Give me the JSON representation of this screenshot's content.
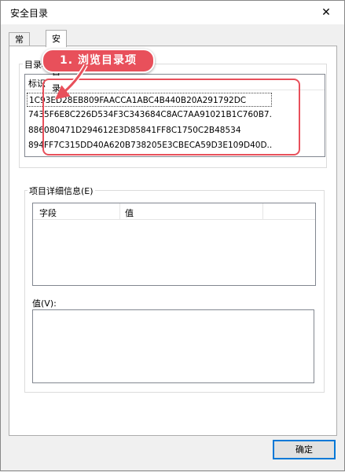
{
  "window": {
    "title": "安全目录",
    "close_glyph": "✕"
  },
  "tabs": [
    {
      "label": "常规"
    },
    {
      "label": "安全目录"
    }
  ],
  "catalog": {
    "group_label": "目录项",
    "column_header": "标识",
    "entries": [
      "1C93ED28EB809FAACCA1ABC4B440B20A291792DC",
      "7435F6E8C226D534F3C343684C8AC7AA91021B1C760B7...",
      "886080471D294612E3D85841FF8C1750C2B48534",
      "894FF7C315DD40A620B738205E3CBECA59D3E109D40D..."
    ],
    "selected_index": 0
  },
  "details": {
    "group_label": "项目详细信息(E)",
    "columns": [
      "字段",
      "值"
    ],
    "value_label": "值(V):"
  },
  "buttons": {
    "ok": "确定"
  },
  "annotation": {
    "text": "1. 浏览目录项",
    "color": "#e8505b"
  }
}
